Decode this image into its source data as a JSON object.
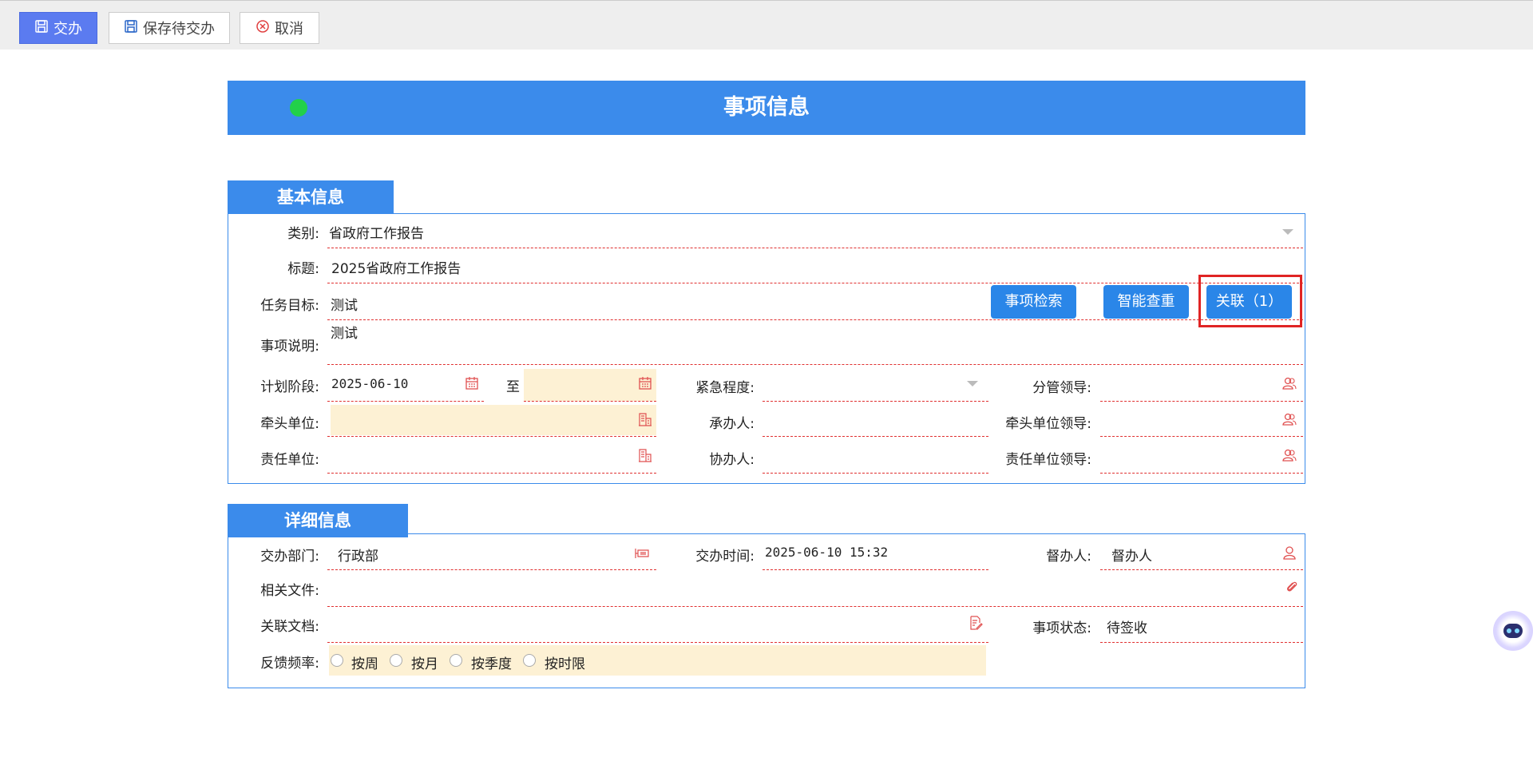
{
  "toolbar": {
    "submit_label": "交办",
    "save_label": "保存待交办",
    "cancel_label": "取消"
  },
  "header": {
    "title": "事项信息"
  },
  "basic": {
    "section_title": "基本信息",
    "category_label": "类别:",
    "category_value": "省政府工作报告",
    "title_label": "标题:",
    "title_value": "2025省政府工作报告",
    "goal_label": "任务目标:",
    "goal_value": "测试",
    "desc_label": "事项说明:",
    "desc_value": "测试",
    "search_btn": "事项检索",
    "smart_btn": "智能查重",
    "relate_btn": "关联（1）",
    "plan_label": "计划阶段:",
    "plan_start": "2025-06-10",
    "plan_to": "至",
    "plan_end": "",
    "urgency_label": "紧急程度:",
    "urgency_value": "",
    "leader_label": "分管领导:",
    "lead_unit_label": "牵头单位:",
    "handler_label": "承办人:",
    "lead_unit_leader_label": "牵头单位领导:",
    "resp_unit_label": "责任单位:",
    "assist_label": "协办人:",
    "resp_unit_leader_label": "责任单位领导:"
  },
  "detail": {
    "section_title": "详细信息",
    "dept_label": "交办部门:",
    "dept_value": "行政部",
    "time_label": "交办时间:",
    "time_value": "2025-06-10 15:32",
    "supervisor_label": "督办人:",
    "supervisor_value": "督办人",
    "files_label": "相关文件:",
    "docs_label": "关联文档:",
    "status_label": "事项状态:",
    "status_value": "待签收",
    "freq_label": "反馈频率:",
    "freq_options": [
      "按周",
      "按月",
      "按季度",
      "按时限"
    ]
  },
  "colors": {
    "accent": "#3b8beb",
    "button": "#2a86e8",
    "required_fill": "#fdf1d4",
    "line": "#e03030",
    "highlight": "#e02424"
  }
}
